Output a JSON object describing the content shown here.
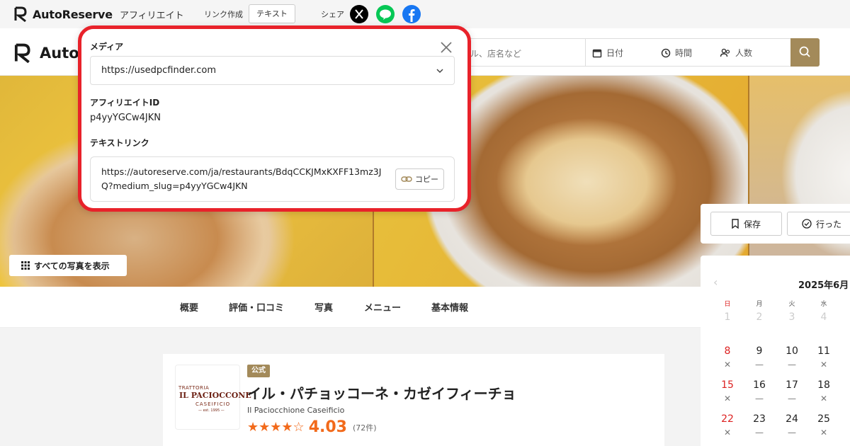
{
  "affbar": {
    "brand": "AutoReserve",
    "section": "アフィリエイト",
    "link_label": "リンク作成",
    "text_button": "テキスト",
    "share_label": "シェア",
    "social_icons": [
      "x-icon",
      "line-icon",
      "facebook-icon"
    ]
  },
  "header": {
    "brand": "AutoReserve",
    "search_placeholder": "ル、店名など",
    "date_label": "日付",
    "time_label": "時間",
    "people_label": "人数",
    "accent_color": "#a38a5a"
  },
  "photos": {
    "all_photos_label": "すべての写真を表示"
  },
  "tabs": [
    "概要",
    "評価・口コミ",
    "写真",
    "メニュー",
    "基本情報"
  ],
  "restaurant": {
    "logo_lines": [
      "TRATTORIA",
      "IL PACIOCCONE",
      "CASEIFICIO",
      "— est. 1995 —"
    ],
    "official_badge": "公式",
    "name": "イル・パチョッコーネ・カゼイフィーチョ",
    "name_en": "Il Paciocchione Caseificio",
    "stars": "★★★★☆",
    "rating": "4.03",
    "review_count": "(72件)",
    "rating_color": "#f26a1b"
  },
  "sidebar": {
    "save_label": "保存",
    "visited_label": "行った",
    "calendar": {
      "title": "2025年6月",
      "weekdays": [
        "日",
        "月",
        "火",
        "水"
      ],
      "rows": [
        [
          {
            "d": "1",
            "m": ""
          },
          {
            "d": "2",
            "m": ""
          },
          {
            "d": "3",
            "m": ""
          },
          {
            "d": "4",
            "m": ""
          }
        ],
        [
          {
            "d": "8",
            "m": "✕"
          },
          {
            "d": "9",
            "m": "—"
          },
          {
            "d": "10",
            "m": "—"
          },
          {
            "d": "11",
            "m": "✕"
          }
        ],
        [
          {
            "d": "15",
            "m": "✕"
          },
          {
            "d": "16",
            "m": "—"
          },
          {
            "d": "17",
            "m": "—"
          },
          {
            "d": "18",
            "m": "✕"
          }
        ],
        [
          {
            "d": "22",
            "m": "✕"
          },
          {
            "d": "23",
            "m": "—"
          },
          {
            "d": "24",
            "m": "—"
          },
          {
            "d": "25",
            "m": "✕"
          }
        ]
      ]
    }
  },
  "modal": {
    "media_label": "メディア",
    "media_value": "https://usedpcfinder.com",
    "affiliate_id_label": "アフィリエイトID",
    "affiliate_id": "p4yyYGCw4JKN",
    "text_link_label": "テキストリンク",
    "text_link": "https://autoreserve.com/ja/restaurants/BdqCCKJMxKXFF13mz3JQ?medium_slug=p4yyYGCw4JKN",
    "copy_label": "コピー",
    "border_color": "#e8222a"
  }
}
